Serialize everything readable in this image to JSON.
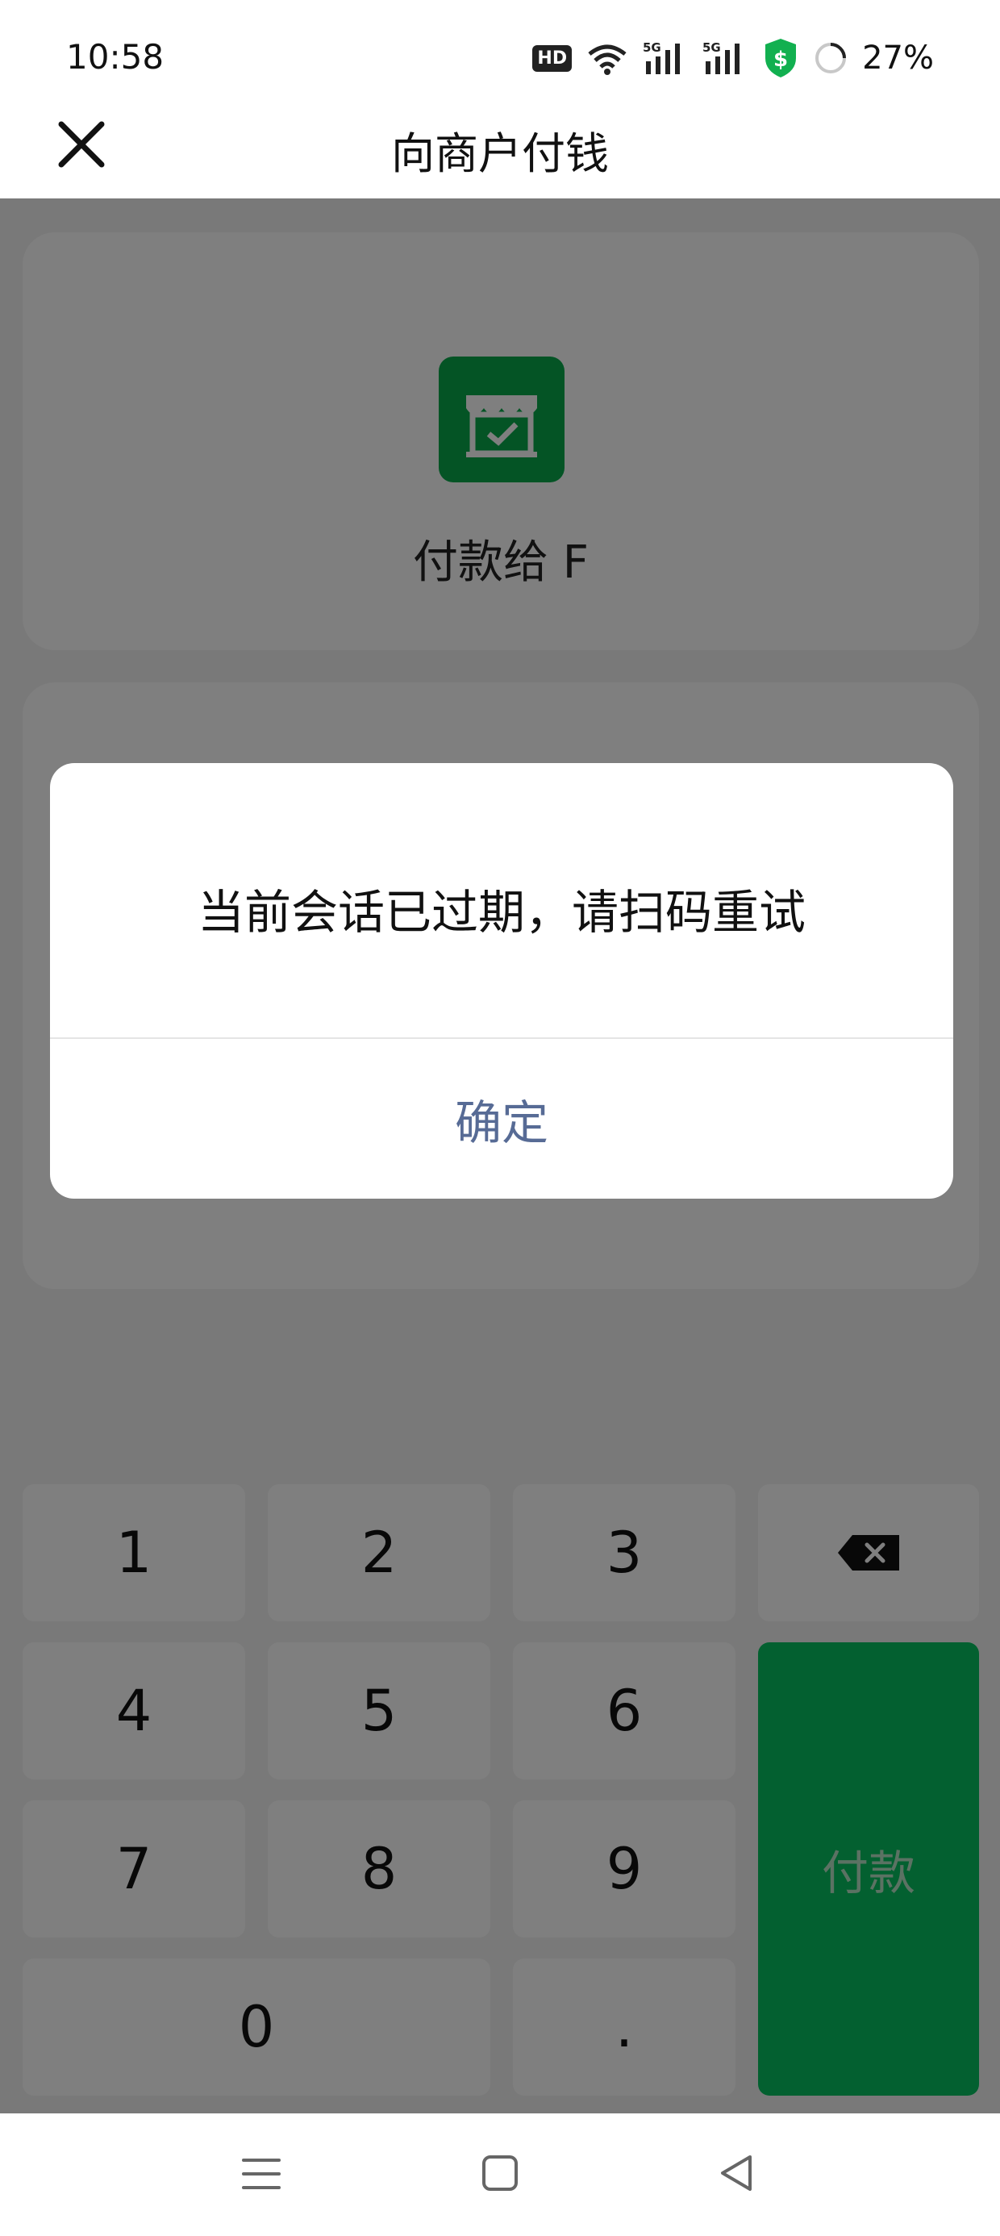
{
  "status_bar": {
    "time": "10:58",
    "hd_badge": "HD",
    "battery_percent": "27%",
    "icons": [
      "hd-icon",
      "wifi-icon",
      "5g-signal-icon",
      "5g-signal-icon",
      "security-shield-icon",
      "battery-icon"
    ]
  },
  "nav": {
    "title": "向商户付钱",
    "close_icon": "close-icon"
  },
  "merchant": {
    "icon": "store-icon",
    "pay_to": "付款给 F"
  },
  "dialog": {
    "message": "当前会话已过期，请扫码重试",
    "confirm_label": "确定"
  },
  "keypad": {
    "keys": [
      "1",
      "2",
      "3",
      "4",
      "5",
      "6",
      "7",
      "8",
      "9",
      "0",
      "."
    ],
    "delete_icon": "backspace-icon",
    "pay_label": "付款"
  },
  "system_nav": {
    "icons": [
      "menu-icon",
      "home-icon",
      "back-icon"
    ]
  },
  "colors": {
    "brand_green": "#07c160",
    "link_blue": "#576b95",
    "overlay": "rgba(0,0,0,0.5)"
  }
}
